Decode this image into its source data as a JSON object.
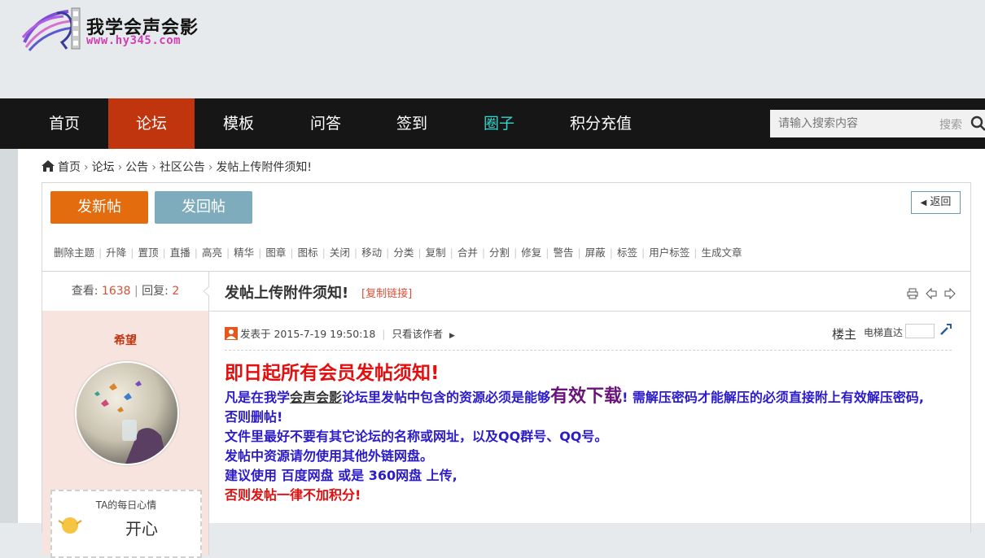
{
  "site": {
    "name": "我学会声会影",
    "url": "www.hy345.com"
  },
  "nav": {
    "items": [
      "首页",
      "论坛",
      "模板",
      "问答",
      "签到",
      "圈子",
      "积分充值"
    ],
    "active": "论坛",
    "search_placeholder": "请输入搜索内容",
    "search_button": "搜索"
  },
  "breadcrumb": [
    "首页",
    "论坛",
    "公告",
    "社区公告",
    "发帖上传附件须知!"
  ],
  "buttons": {
    "new_post": "发新帖",
    "reply": "发回帖",
    "back": "返回"
  },
  "mod_tools": [
    "删除主题",
    "升降",
    "置顶",
    "直播",
    "高亮",
    "精华",
    "图章",
    "图标",
    "关闭",
    "移动",
    "分类",
    "复制",
    "合并",
    "分割",
    "修复",
    "警告",
    "屏蔽",
    "标签",
    "用户标签",
    "生成文章"
  ],
  "stats": {
    "views_label": "查看:",
    "views": "1638",
    "replies_label": "回复:",
    "replies": "2"
  },
  "thread": {
    "title": "发帖上传附件须知!",
    "copy_link": "[复制链接]"
  },
  "author": {
    "name": "希望",
    "mood_title": "TA的每日心情",
    "mood_value": "开心"
  },
  "post_meta": {
    "posted_at": "发表于 2015-7-19 19:50:18",
    "only_author": "只看该作者",
    "floor": "楼主",
    "elevator": "电梯直达"
  },
  "post": {
    "heading": "即日起所有会员发帖须知!",
    "line1_a": "凡是在我学",
    "line1_link": "会声会影",
    "line1_b": "论坛里发帖中包含的资源必须是能够",
    "line1_big": "有效下载",
    "line1_c": "! 需解压密码才能解压的必须直接附上有效解压密码,",
    "line2": "否则删帖!",
    "line3": "文件里最好不要有其它论坛的名称或网址，以及QQ群号、QQ号。",
    "line4": "发帖中资源请勿使用其他外链网盘。",
    "line5": "建议使用 百度网盘 或是 360网盘 上传,",
    "line6": "否则发帖一律不加积分!"
  },
  "colors": {
    "nav_bg": "#161616",
    "active": "#c0340e",
    "accent_teal": "#33d6cc",
    "new_post": "#e26c0e",
    "reply": "#7eacbd",
    "author_bg": "#f8e4df"
  }
}
